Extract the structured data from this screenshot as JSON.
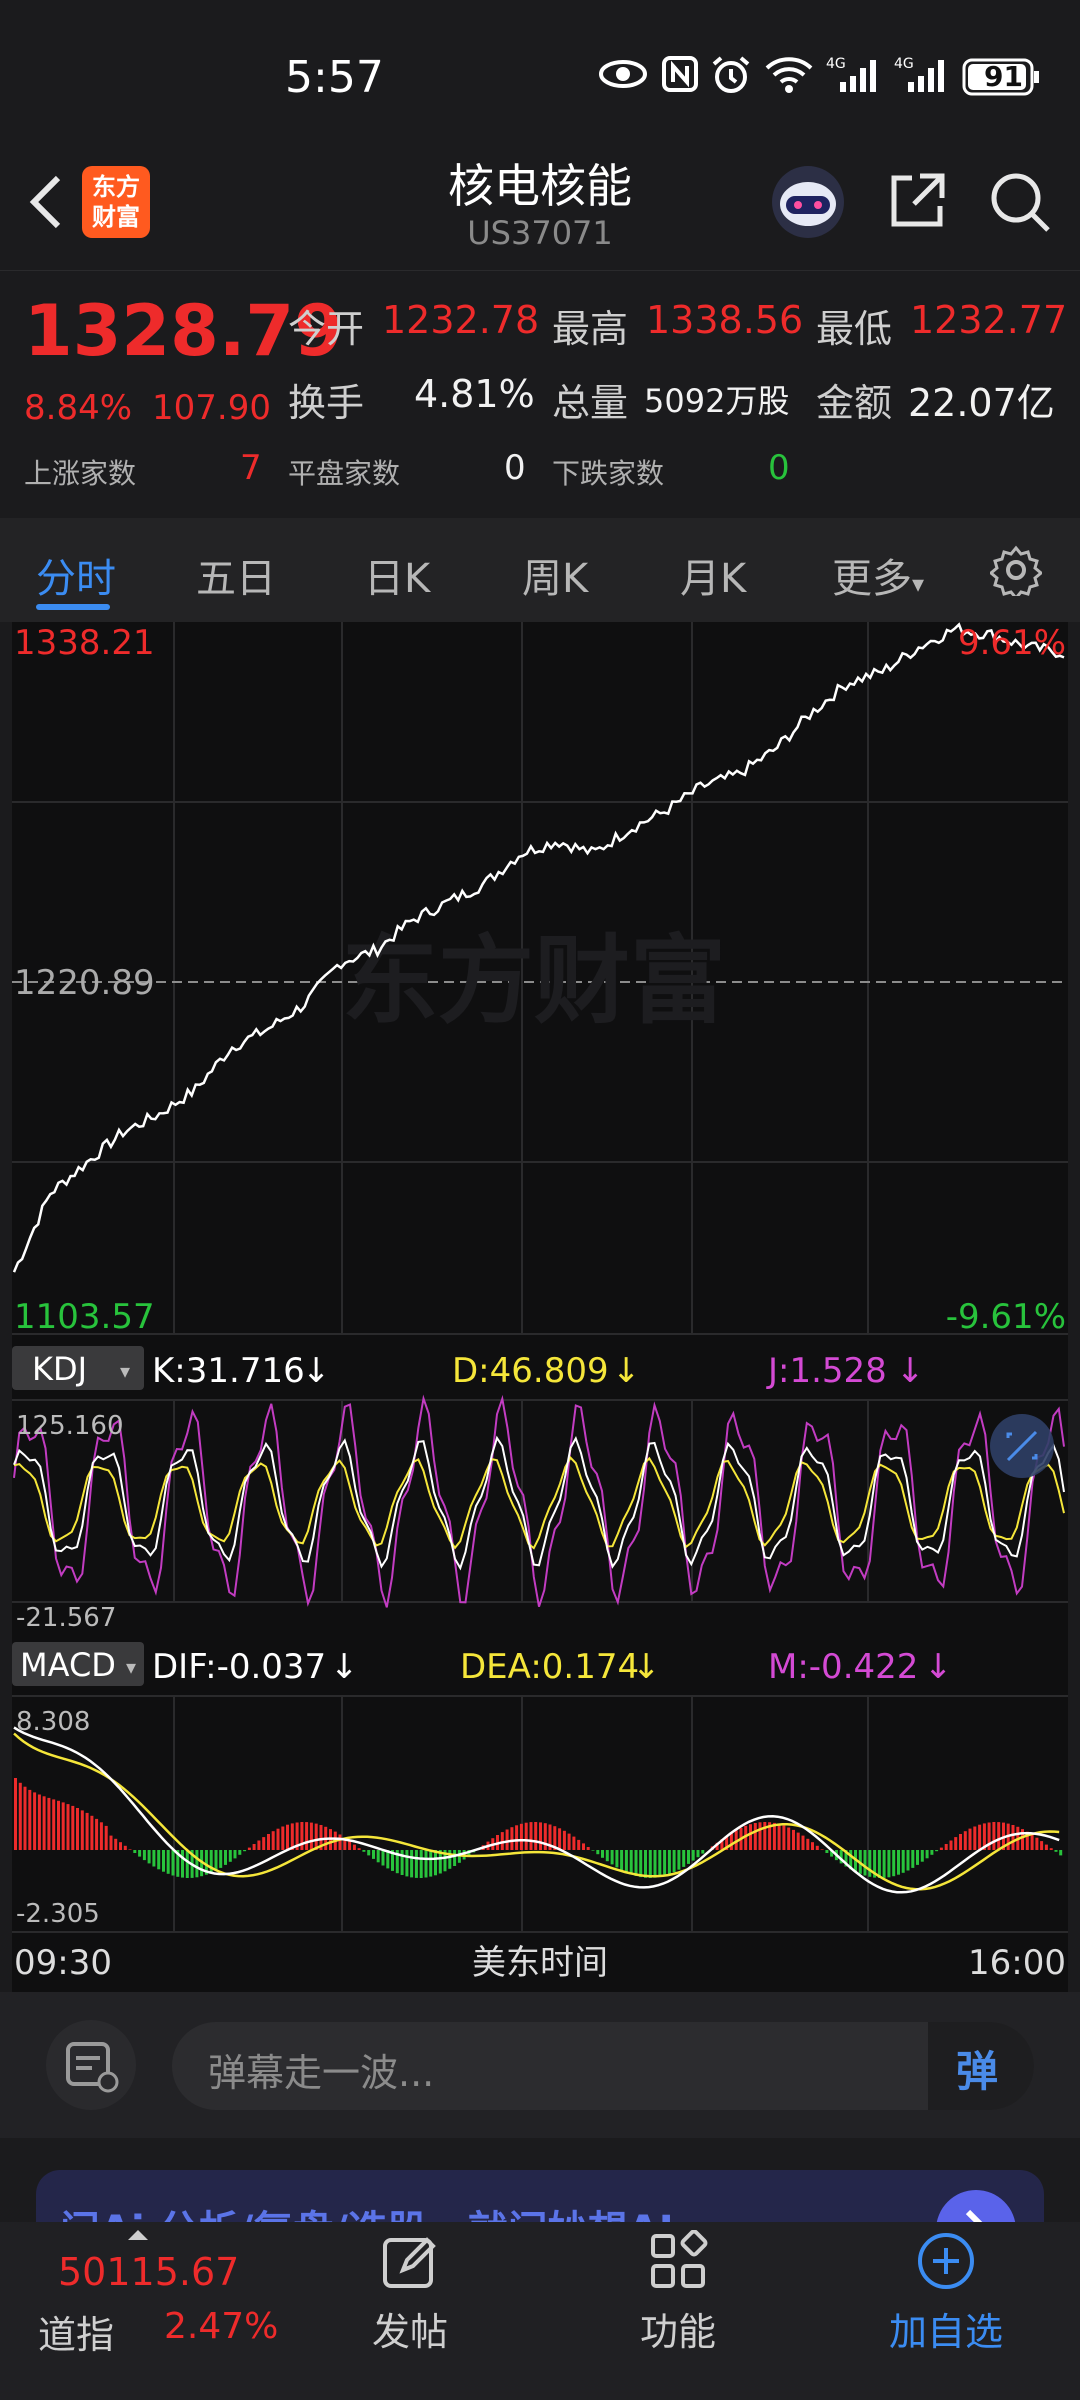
{
  "status_bar": {
    "time": "5:57",
    "battery": "91",
    "network1": "4G",
    "network2": "4G"
  },
  "header": {
    "back_icon": "chevron-left-icon",
    "logo_line1": "东方",
    "logo_line2": "财富",
    "title": "核电核能",
    "subtitle": "US37071",
    "share_icon": "share-icon",
    "search_icon": "search-icon"
  },
  "quote": {
    "price": "1328.79",
    "change_pct": "8.84%",
    "change_abs": "107.90",
    "open_label": "今开",
    "open_value": "1232.78",
    "high_label": "最高",
    "high_value": "1338.56",
    "low_label": "最低",
    "low_value": "1232.77",
    "turnover_label": "换手",
    "turnover_value": "4.81%",
    "volume_label": "总量",
    "volume_value": "5092万股",
    "amount_label": "金额",
    "amount_value": "22.07亿",
    "up_label": "上涨家数",
    "up_value": "7",
    "flat_label": "平盘家数",
    "flat_value": "0",
    "down_label": "下跌家数",
    "down_value": "0"
  },
  "tabs": {
    "items": [
      "分时",
      "五日",
      "日K",
      "周K",
      "月K",
      "更多"
    ],
    "active": "分时",
    "more_caret": "▾",
    "settings_icon": "gear-icon"
  },
  "chart": {
    "watermark": "东方财富",
    "price_top": "1338.21",
    "price_mid": "1220.89",
    "price_bottom": "1103.57",
    "pct_top": "9.61%",
    "pct_bottom": "-9.61%",
    "kdj": {
      "selector": "KDJ",
      "k_label": "K:31.716",
      "d_label": "D:46.809",
      "j_label": "J:1.528",
      "arrow": "↓",
      "max": "125.160",
      "min": "-21.567"
    },
    "macd": {
      "selector": "MACD",
      "dif_label": "DIF:-0.037",
      "dea_label": "DEA:0.174",
      "m_label": "M:-0.422",
      "arrow": "↓",
      "max": "8.308",
      "min": "-2.305"
    },
    "time_start": "09:30",
    "time_mid": "美东时间",
    "time_end": "16:00",
    "colors": {
      "up": "#ee2b2b",
      "down": "#28c33c",
      "line": "#ffffff",
      "d_line": "#f5e63a",
      "j_line": "#c23cc2"
    }
  },
  "comment": {
    "placeholder": "弹幕走一波...",
    "danmaku_label": "弹"
  },
  "banner": {
    "text": "问Ai  分析/复盘/选股，就问妙想AI"
  },
  "chart_data": {
    "type": "line",
    "title": "核电核能",
    "x": [
      "09:30",
      "16:00"
    ],
    "ylim": [
      1103.57,
      1338.21
    ],
    "baseline": 1220.89,
    "series": [
      {
        "values": [
          1124,
          1150,
          1160,
          1170,
          1176,
          1184,
          1198,
          1204,
          1212,
          1226,
          1230,
          1240,
          1246,
          1252,
          1262,
          1266,
          1262,
          1270,
          1276,
          1284,
          1288,
          1296,
          1308,
          1318,
          1322,
          1330,
          1336,
          1334,
          1330,
          1328
        ]
      }
    ]
  },
  "bottom_bar": {
    "index_value": "50115.67",
    "index_name": "道指",
    "index_change": "2.47%",
    "post_label": "发帖",
    "func_label": "功能",
    "add_label": "加自选"
  }
}
